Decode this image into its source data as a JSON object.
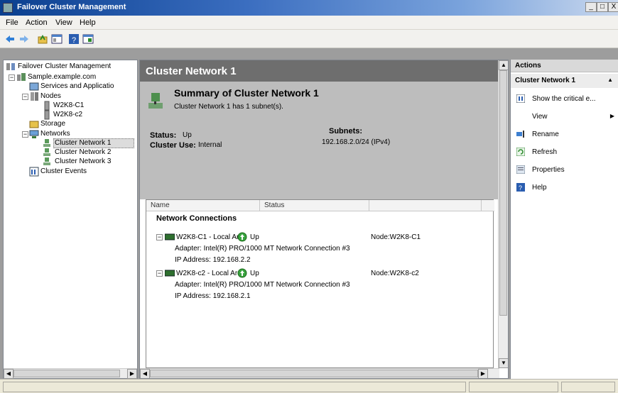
{
  "window": {
    "title": "Failover Cluster Management"
  },
  "menu": [
    "File",
    "Action",
    "View",
    "Help"
  ],
  "tree": {
    "root": "Failover Cluster Management",
    "cluster": "Sample.example.com",
    "services": "Services and Applicatio",
    "nodes": "Nodes",
    "node_items": [
      "W2K8-C1",
      "W2K8-c2"
    ],
    "storage": "Storage",
    "networks": "Networks",
    "network_items": [
      "Cluster Network 1",
      "Cluster Network 2",
      "Cluster Network 3"
    ],
    "events": "Cluster Events"
  },
  "center": {
    "title": "Cluster Network 1",
    "summary_title": "Summary of Cluster Network 1",
    "summary_sub": "Cluster Network 1 has 1 subnet(s).",
    "status_label": "Status:",
    "status_value": "Up",
    "cluster_use_label": "Cluster Use:",
    "cluster_use_value": "Internal",
    "subnets_label": "Subnets:",
    "subnets_value": "192.168.2.0/24 (IPv4)",
    "columns": [
      "Name",
      "Status"
    ],
    "group": "Network Connections",
    "connections": [
      {
        "name": "W2K8-C1 - Local Are..",
        "status": "Up",
        "node": "Node:W2K8-C1",
        "adapter": "Adapter: Intel(R) PRO/1000 MT Network Connection #3",
        "ip": "IP Address: 192.168.2.2"
      },
      {
        "name": "W2K8-c2 - Local Are..",
        "status": "Up",
        "node": "Node:W2K8-c2",
        "adapter": "Adapter: Intel(R) PRO/1000 MT Network Connection #3",
        "ip": "IP Address: 192.168.2.1"
      }
    ]
  },
  "actions": {
    "header": "Actions",
    "subheader": "Cluster Network 1",
    "items": [
      "Show the critical e...",
      "View",
      "Rename",
      "Refresh",
      "Properties",
      "Help"
    ]
  }
}
